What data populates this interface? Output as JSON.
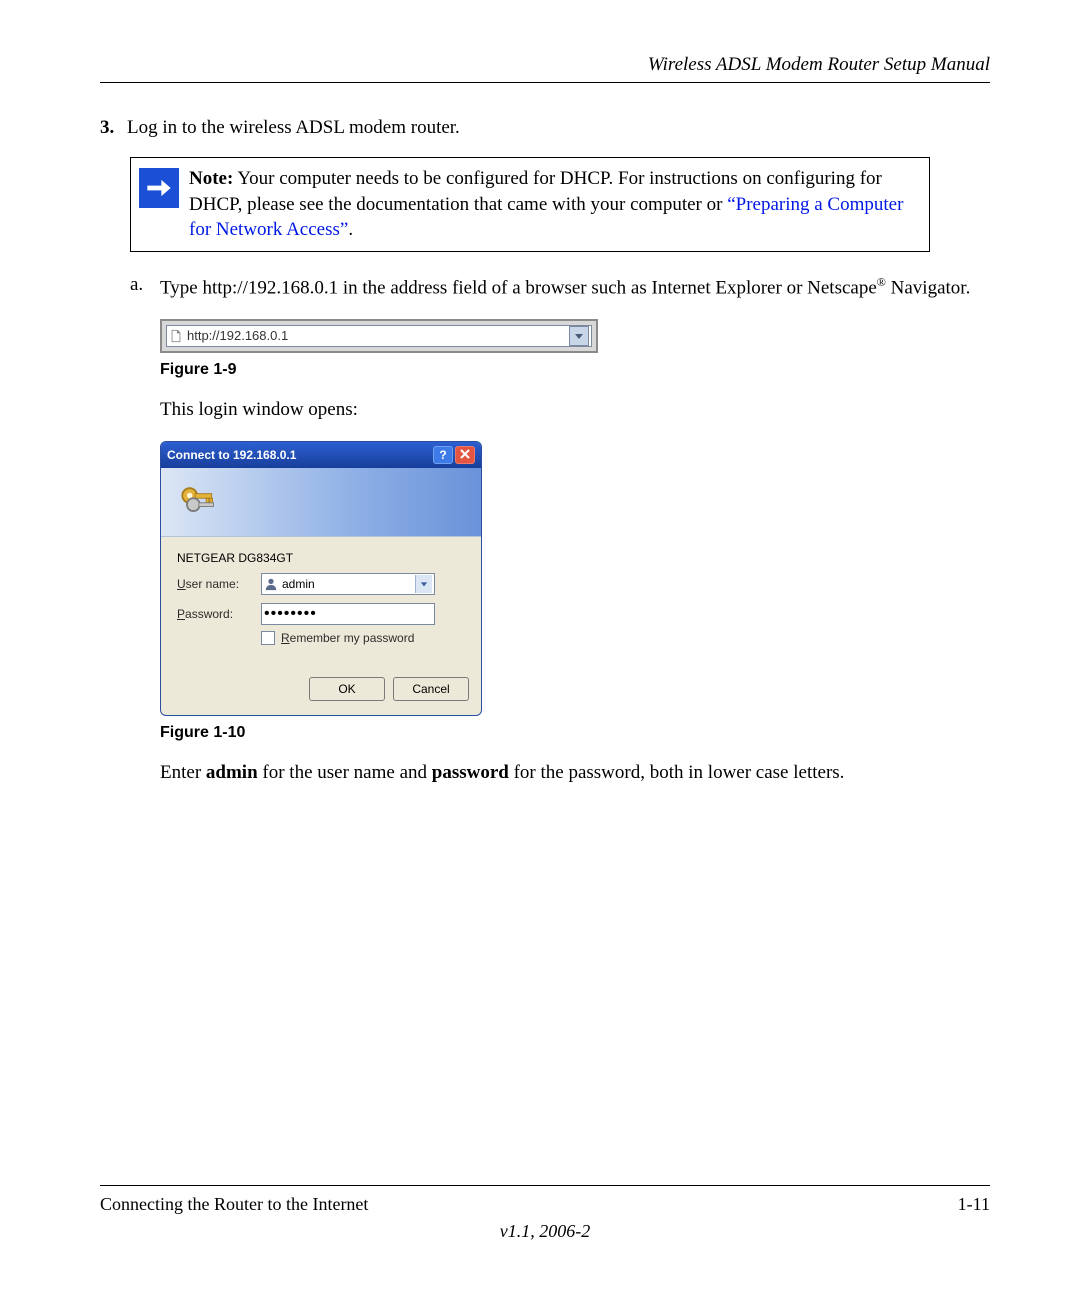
{
  "header": {
    "title": "Wireless ADSL Modem Router Setup Manual"
  },
  "step": {
    "number": "3.",
    "text": "Log in to the wireless ADSL modem router."
  },
  "note": {
    "label": "Note:",
    "body_pre": " Your computer needs to be configured for DHCP. For instructions on configuring for DHCP, please see the documentation that came with your computer or ",
    "link": "“Preparing a Computer for Network Access”",
    "body_post": "."
  },
  "sub": {
    "marker": "a.",
    "text_pre": "Type http://192.168.0.1 in the address field of a browser such as Internet Explorer or Netscape",
    "reg": "®",
    "text_post": " Navigator."
  },
  "addr_bar": {
    "url": "http://192.168.0.1"
  },
  "fig9": "Figure 1-9",
  "login_intro": "This login window opens:",
  "dialog": {
    "title": "Connect to 192.168.0.1",
    "device": "NETGEAR DG834GT",
    "user_label_u": "U",
    "user_label_rest": "ser name:",
    "user_value": " admin",
    "pass_label_u": "P",
    "pass_label_rest": "assword:",
    "pass_value": "••••••••",
    "remember_u": "R",
    "remember_rest": "emember my password",
    "ok": "OK",
    "cancel": "Cancel"
  },
  "fig10": "Figure 1-10",
  "enter_line": {
    "pre": "Enter ",
    "admin": "admin",
    "mid": " for the user name and ",
    "password": "password",
    "post": " for the password, both in lower case letters."
  },
  "footer": {
    "left": "Connecting the Router to the Internet",
    "right": "1-11",
    "version": "v1.1, 2006-2"
  }
}
